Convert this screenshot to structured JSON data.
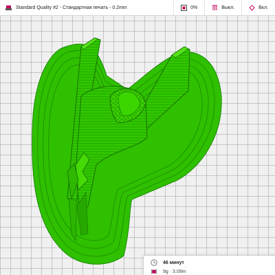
{
  "toolbar": {
    "profile_label": "Standard Quality #2 - Стандартная печать - 0.2mm",
    "infill_label": "0%",
    "support_label": "Выкл.",
    "adhesion_label": "Вкл."
  },
  "estimate": {
    "time_label": "46 минут",
    "material_label": "9g · 3.09m"
  },
  "colors": {
    "model": "#33cc00",
    "build_plate": "#f0f0f0",
    "grid": "#8a8a8a",
    "accent": "#c0005a"
  }
}
